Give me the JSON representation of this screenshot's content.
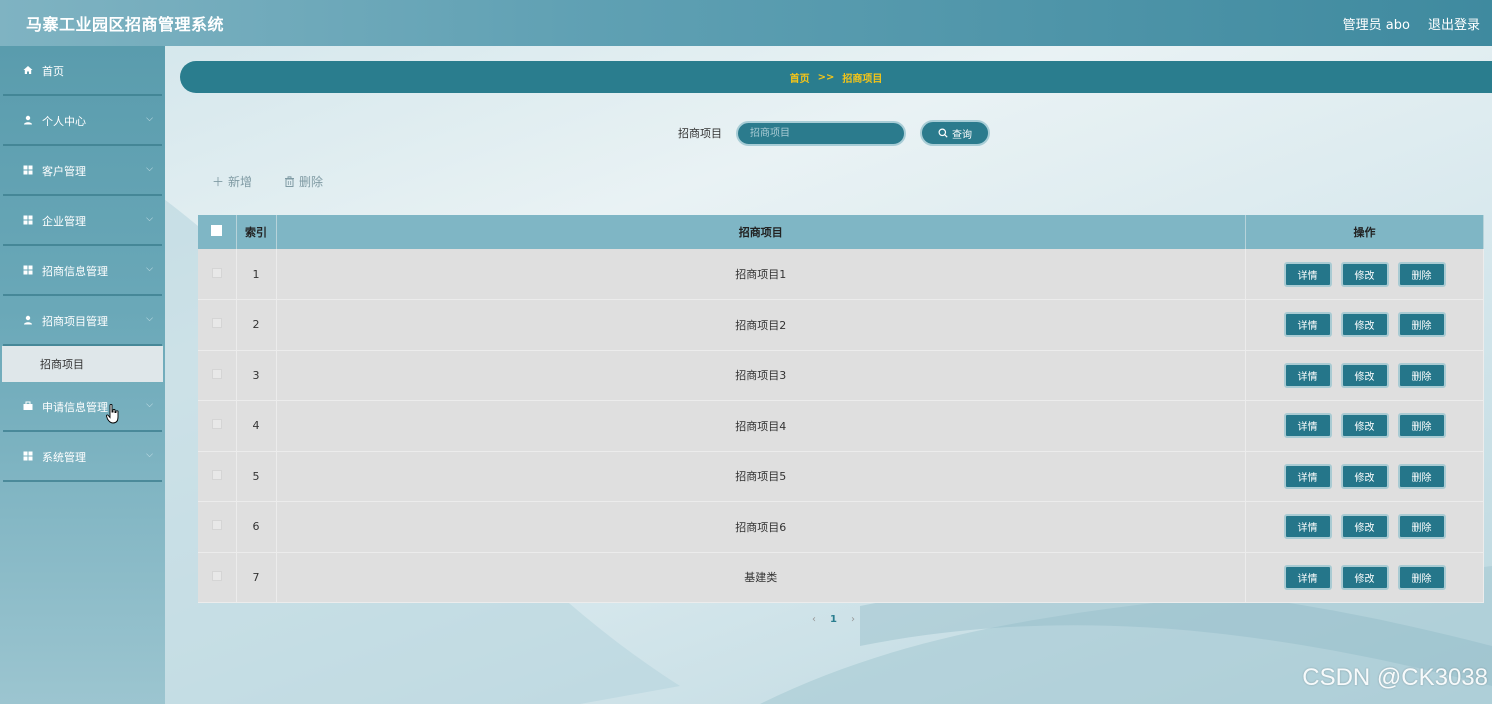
{
  "header": {
    "title": "马寨工业园区招商管理系统",
    "user_label": "管理员 abo",
    "logout_label": "退出登录"
  },
  "sidebar": {
    "items": [
      {
        "label": "首页",
        "icon": "home-icon"
      },
      {
        "label": "个人中心",
        "icon": "user-icon"
      },
      {
        "label": "客户管理",
        "icon": "grid-icon"
      },
      {
        "label": "企业管理",
        "icon": "grid-icon"
      },
      {
        "label": "招商信息管理",
        "icon": "grid-icon"
      },
      {
        "label": "招商项目管理",
        "icon": "user-icon"
      },
      {
        "label": "申请信息管理",
        "icon": "briefcase-icon"
      },
      {
        "label": "系统管理",
        "icon": "grid-icon"
      }
    ],
    "active_sub": "招商项目"
  },
  "breadcrumb": {
    "home": "首页",
    "separator": ">>",
    "current": "招商项目"
  },
  "search": {
    "label": "招商项目",
    "placeholder": "招商项目",
    "button_label": "查询"
  },
  "actions": {
    "add_label": "新增",
    "delete_label": "删除"
  },
  "table": {
    "columns": [
      "索引",
      "招商项目",
      "操作"
    ],
    "rows": [
      {
        "index": "1",
        "name": "招商项目1"
      },
      {
        "index": "2",
        "name": "招商项目2"
      },
      {
        "index": "3",
        "name": "招商项目3"
      },
      {
        "index": "4",
        "name": "招商项目4"
      },
      {
        "index": "5",
        "name": "招商项目5"
      },
      {
        "index": "6",
        "name": "招商项目6"
      },
      {
        "index": "7",
        "name": "基建类"
      }
    ],
    "row_actions": {
      "detail": "详情",
      "edit": "修改",
      "delete": "删除"
    }
  },
  "pagination": {
    "prev": "‹",
    "current_page": "1",
    "next": "›"
  },
  "watermark": "CSDN @CK3038",
  "colors": {
    "primary": "#2a7d8e",
    "breadcrumb_text": "#f5c518",
    "table_header": "#7fb6c5"
  }
}
